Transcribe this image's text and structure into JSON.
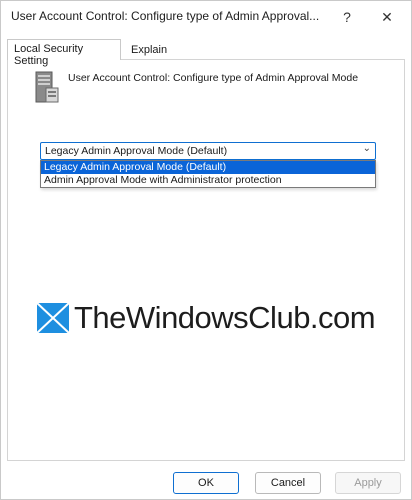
{
  "window": {
    "title": "User Account Control: Configure type of Admin Approval...",
    "help_glyph": "?",
    "close_glyph": "✕"
  },
  "tabs": [
    {
      "label": "Local Security Setting",
      "active": true
    },
    {
      "label": "Explain",
      "active": false
    }
  ],
  "policy": {
    "title": "User Account Control: Configure type of Admin Approval Mode",
    "icon": "server-policy-icon"
  },
  "combo": {
    "selected_value": "Legacy Admin Approval Mode (Default)",
    "arrow_glyph": "⌄",
    "options": [
      "Legacy Admin Approval Mode (Default)",
      "Admin Approval Mode with Administrator protection"
    ],
    "highlighted_index": 0
  },
  "watermark": {
    "text": "TheWindowsClub.com",
    "logo": "windows-logo-icon"
  },
  "buttons": {
    "ok": "OK",
    "cancel": "Cancel",
    "apply": "Apply"
  },
  "colors": {
    "accent": "#0f6fd1",
    "selection": "#0a64d8",
    "logo_blue": "#1e8fe0"
  }
}
